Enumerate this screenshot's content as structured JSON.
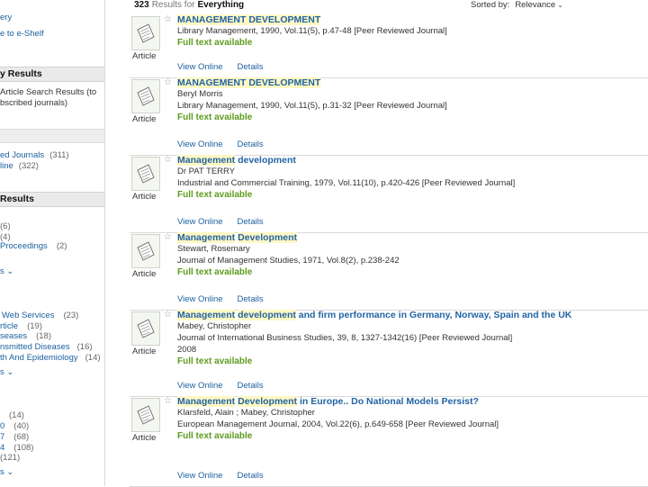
{
  "sidebar": {
    "top_links": [
      "ery",
      "e to e-Shelf"
    ],
    "refine_heading": "y Results",
    "scope_text": [
      "Article Search Results (to",
      "bscribed journals)"
    ],
    "source_items": [
      {
        "label": "ed Journals",
        "count": "(311)"
      },
      {
        "label": "line",
        "count": "(322)"
      }
    ],
    "results_heading": "Results",
    "type_items": [
      {
        "label": "",
        "count": "(6)"
      },
      {
        "label": "",
        "count": "(4)"
      },
      {
        "label": "Proceedings",
        "count": "(2)"
      }
    ],
    "more1": "s ⌄",
    "subject_items": [
      {
        "label": "Web Services",
        "count": "(23)"
      },
      {
        "label": "rticle",
        "count": "(19)"
      },
      {
        "label": "seases",
        "count": "(18)"
      },
      {
        "label": "nsmitted Diseases",
        "count": "(16)"
      },
      {
        "label": "th And Epidemiology",
        "count": "(14)"
      }
    ],
    "more2": "s ⌄",
    "date_items": [
      {
        "label": "",
        "count": "(14)"
      },
      {
        "label": "0",
        "count": "(40)"
      },
      {
        "label": "7",
        "count": "(68)"
      },
      {
        "label": "4",
        "count": "(108)"
      },
      {
        "label": "",
        "count": "(121)"
      }
    ],
    "more3": "s ⌄"
  },
  "header": {
    "count": "323",
    "results_for": "Results for",
    "scope": "Everything",
    "sorted_label": "Sorted by:",
    "sorted_value": "Relevance"
  },
  "results": [
    {
      "type": "Article",
      "title_parts": [
        {
          "t": "MANAGEMENT DEVELOPMENT",
          "h": true
        }
      ],
      "lines": [
        "Library Management, 1990, Vol.11(5), p.47-48 [Peer Reviewed Journal]"
      ],
      "fulltext": "Full text available",
      "view": "View Online",
      "details": "Details"
    },
    {
      "type": "Article",
      "title_parts": [
        {
          "t": "MANAGEMENT DEVELOPMENT",
          "h": true
        }
      ],
      "lines": [
        "Beryl Morris",
        "Library Management, 1990, Vol.11(5), p.31-32 [Peer Reviewed Journal]"
      ],
      "fulltext": "Full text available",
      "view": "View Online",
      "details": "Details"
    },
    {
      "type": "Article",
      "title_parts": [
        {
          "t": "Management",
          "h": true
        },
        {
          "t": " development",
          "h": false
        }
      ],
      "lines": [
        "Dr PAT TERRY",
        "Industrial and Commercial Training, 1979, Vol.11(10), p.420-426 [Peer Reviewed Journal]"
      ],
      "fulltext": "Full text available",
      "view": "View Online",
      "details": "Details"
    },
    {
      "type": "Article",
      "title_parts": [
        {
          "t": "Management",
          "h": true
        },
        {
          "t": " ",
          "h": false
        },
        {
          "t": "Development",
          "h": true
        }
      ],
      "lines": [
        "Stewart, Rosemary",
        "Journal of Management Studies, 1971, Vol.8(2), p.238-242"
      ],
      "fulltext": "Full text available",
      "view": "View Online",
      "details": "Details"
    },
    {
      "type": "Article",
      "title_parts": [
        {
          "t": "Management",
          "h": true
        },
        {
          "t": " ",
          "h": false
        },
        {
          "t": "development",
          "h": true
        },
        {
          "t": " and firm performance in Germany, Norway, Spain and the UK",
          "h": false
        }
      ],
      "lines": [
        "Mabey, Christopher",
        "Journal of International Business Studies, 39, 8, 1327-1342(16) [Peer Reviewed Journal]",
        "2008"
      ],
      "fulltext": "Full text available",
      "view": "View Online",
      "details": "Details"
    },
    {
      "type": "Article",
      "title_parts": [
        {
          "t": "Management",
          "h": true
        },
        {
          "t": " ",
          "h": false
        },
        {
          "t": "Development",
          "h": true
        },
        {
          "t": " in Europe.. Do National Models Persist?",
          "h": false
        }
      ],
      "lines": [
        "Klarsfeld, Alain ; Mabey, Christopher",
        "European Management Journal, 2004, Vol.22(6), p.649-658 [Peer Reviewed Journal]"
      ],
      "fulltext": "Full text available",
      "view": "View Online",
      "details": "Details"
    }
  ]
}
